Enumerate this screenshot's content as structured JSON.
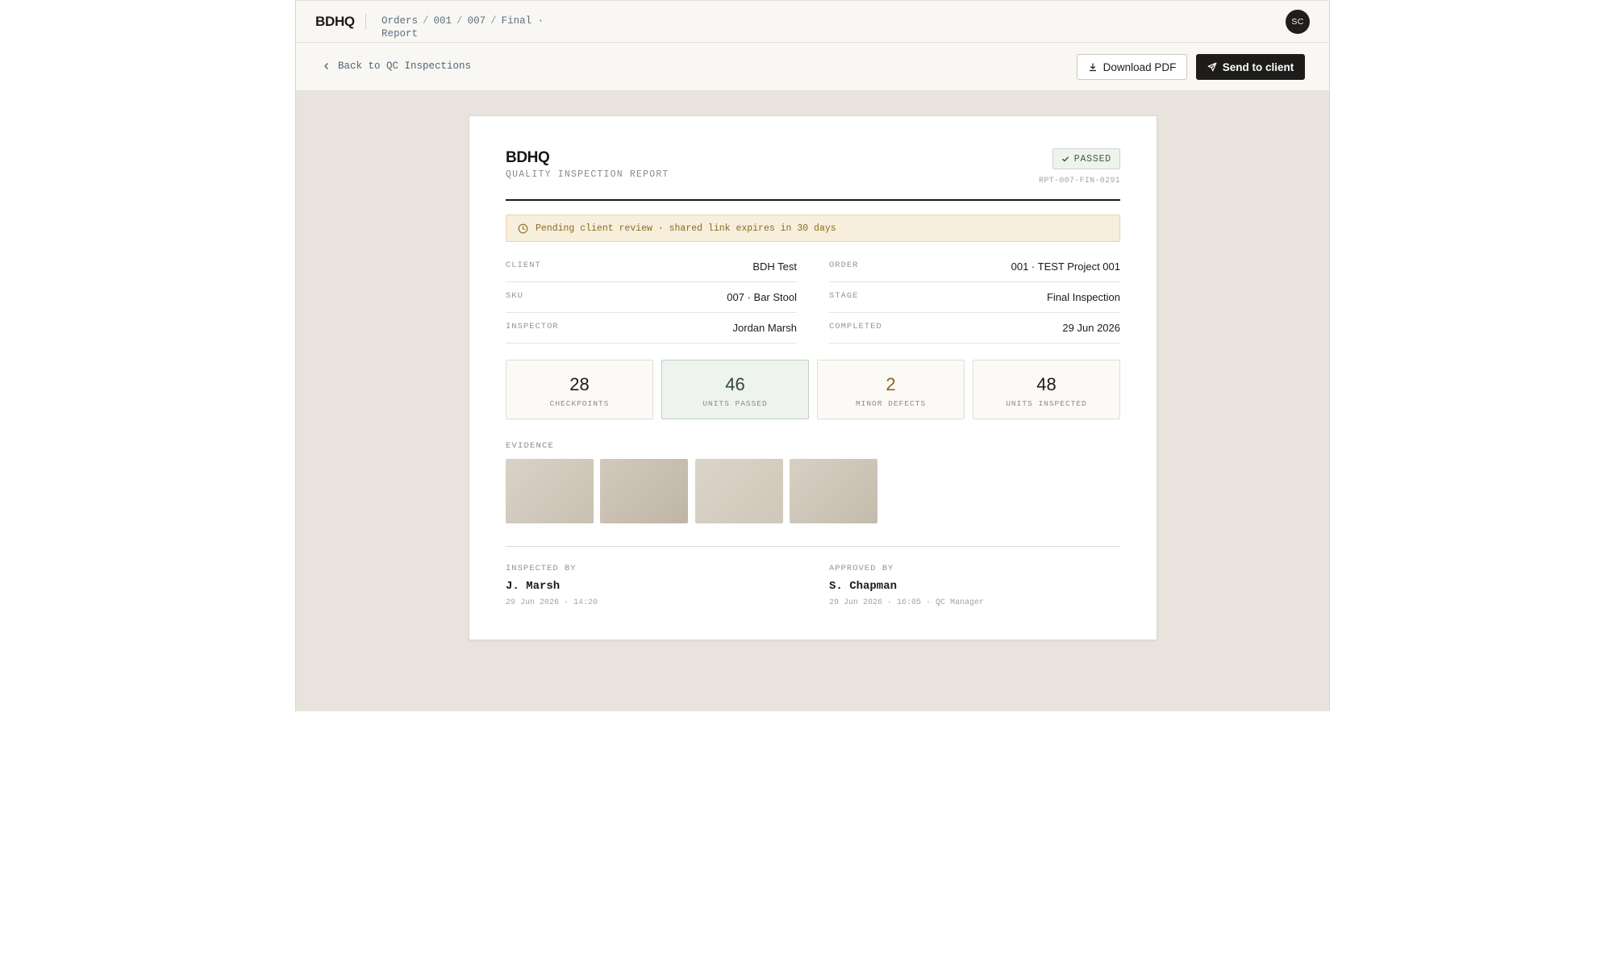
{
  "app": {
    "brand": "BDHQ",
    "breadcrumb": [
      "Orders",
      "001",
      "007",
      "Final · Report"
    ],
    "avatar_initials": "SC"
  },
  "actions": {
    "back_label": "Back to QC Inspections",
    "download_label": "Download PDF",
    "send_label": "Send to client"
  },
  "report": {
    "brand": "BDHQ",
    "subtitle": "QUALITY INSPECTION REPORT",
    "status": "PASSED",
    "report_id": "RPT-007-FIN-0291",
    "notice": "Pending client review · shared link expires in 30 days",
    "meta": [
      {
        "key": "CLIENT",
        "value": "BDH Test"
      },
      {
        "key": "ORDER",
        "value": "001 · TEST Project 001"
      },
      {
        "key": "SKU",
        "value": "007 · Bar Stool"
      },
      {
        "key": "STAGE",
        "value": "Final Inspection"
      },
      {
        "key": "INSPECTOR",
        "value": "Jordan Marsh"
      },
      {
        "key": "COMPLETED",
        "value": "29 Jun 2026"
      }
    ],
    "stats": [
      {
        "value": "28",
        "label": "CHECKPOINTS"
      },
      {
        "value": "46",
        "label": "UNITS PASSED"
      },
      {
        "value": "2",
        "label": "MINOR DEFECTS"
      },
      {
        "value": "48",
        "label": "UNITS INSPECTED"
      }
    ],
    "evidence_label": "EVIDENCE",
    "signatures": {
      "inspected": {
        "label": "INSPECTED BY",
        "name": "J. Marsh",
        "detail": "29 Jun 2026 · 14:20"
      },
      "approved": {
        "label": "APPROVED BY",
        "name": "S. Chapman",
        "detail": "29 Jun 2026 · 16:05 · QC Manager"
      }
    }
  },
  "colors": {
    "page_bg": "#e8e3dc",
    "bar_bg": "#f8f7f3",
    "primary_button": "#1d1c1a",
    "passed_badge": "#3e5c40",
    "notice_text": "#8a6a22",
    "warn_number": "#8a6514"
  },
  "icons": {
    "back": "chevron-left-icon",
    "download": "download-icon",
    "send": "send-icon",
    "badge": "check-icon",
    "notice": "clock-icon"
  }
}
